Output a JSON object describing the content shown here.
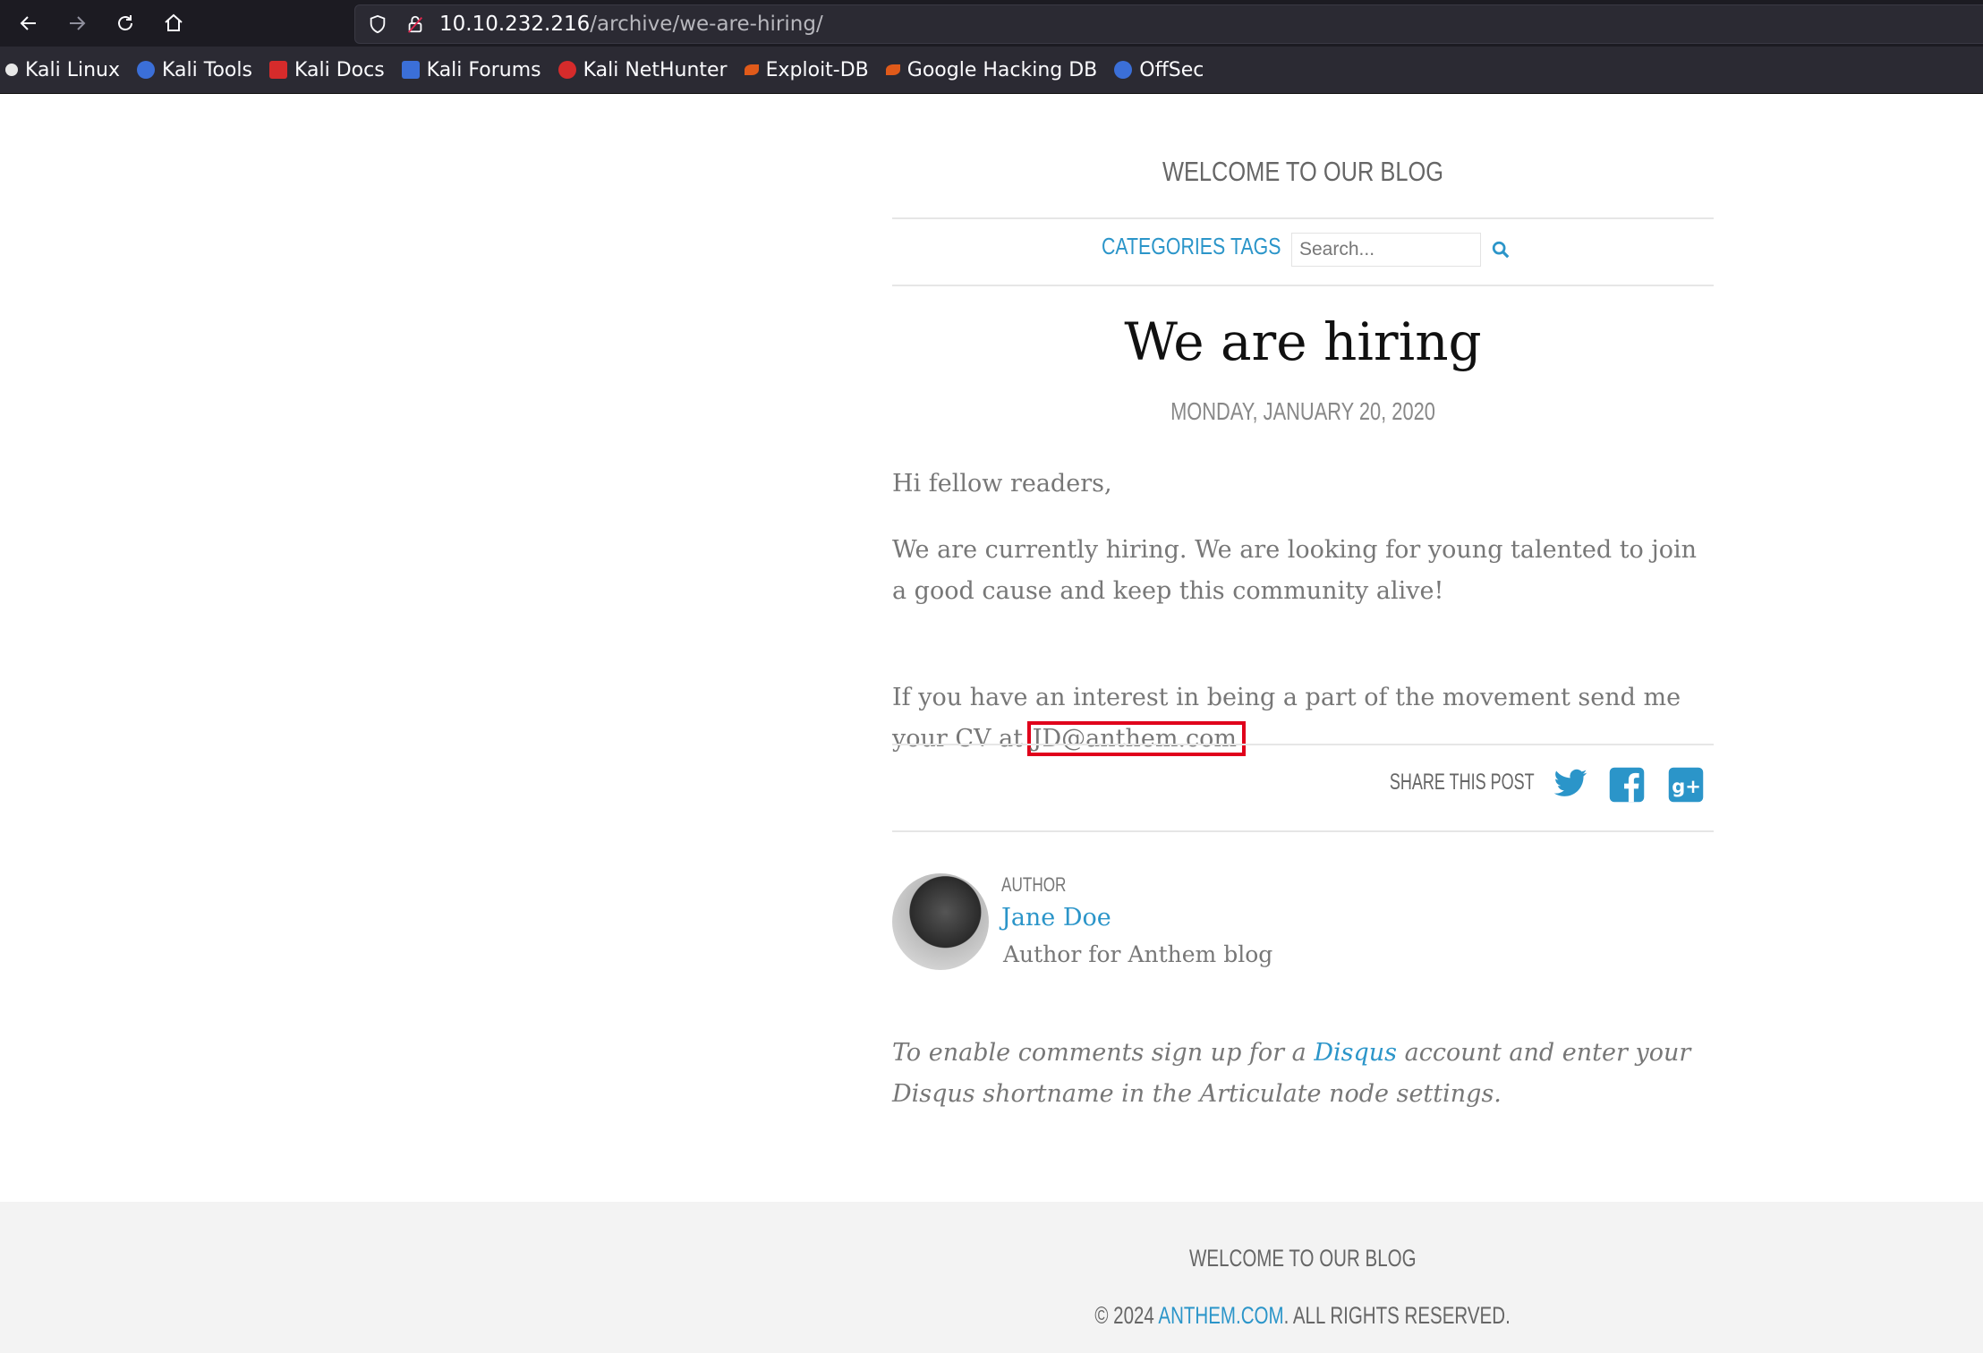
{
  "browser": {
    "url_host": "10.10.232.216",
    "url_path": "/archive/we-are-hiring/",
    "bookmarks": [
      {
        "label": "Kali Linux",
        "color": "#e8e8e8"
      },
      {
        "label": "Kali Tools",
        "color": "#3b6fd8"
      },
      {
        "label": "Kali Docs",
        "color": "#d62b2b"
      },
      {
        "label": "Kali Forums",
        "color": "#3b6fd8"
      },
      {
        "label": "Kali NetHunter",
        "color": "#d62b2b"
      },
      {
        "label": "Exploit-DB",
        "color": "#e05a1a"
      },
      {
        "label": "Google Hacking DB",
        "color": "#e05a1a"
      },
      {
        "label": "OffSec",
        "color": "#3b6fd8"
      }
    ]
  },
  "site": {
    "title": "WELCOME TO OUR BLOG",
    "menu": {
      "categories": "CATEGORIES",
      "tags": "TAGS",
      "search_placeholder": "Search..."
    }
  },
  "post": {
    "title": "We are hiring",
    "date": "MONDAY, JANUARY 20, 2020",
    "p1": "Hi fellow readers,",
    "p2": "We are currently hiring. We are looking for young talented to join a good cause and keep this community alive!",
    "p3_prefix": "If you have an interest in being a part of the movement send me your CV at ",
    "email": "JD@anthem.com",
    "share_label": "SHARE THIS POST"
  },
  "author": {
    "label": "AUTHOR",
    "name": "Jane Doe",
    "bio": "Author for Anthem blog"
  },
  "comments": {
    "prefix": "To enable comments sign up for a ",
    "link": "Disqus",
    "suffix": " account and enter your Disqus shortname in the Articulate node settings."
  },
  "footer": {
    "title": "WELCOME TO OUR BLOG",
    "copyright_prefix": "© 2024 ",
    "copyright_link": "ANTHEM.COM",
    "copyright_suffix": ". ALL RIGHTS RESERVED."
  },
  "colors": {
    "link": "#2b95c9",
    "highlight": "#e0001b"
  }
}
